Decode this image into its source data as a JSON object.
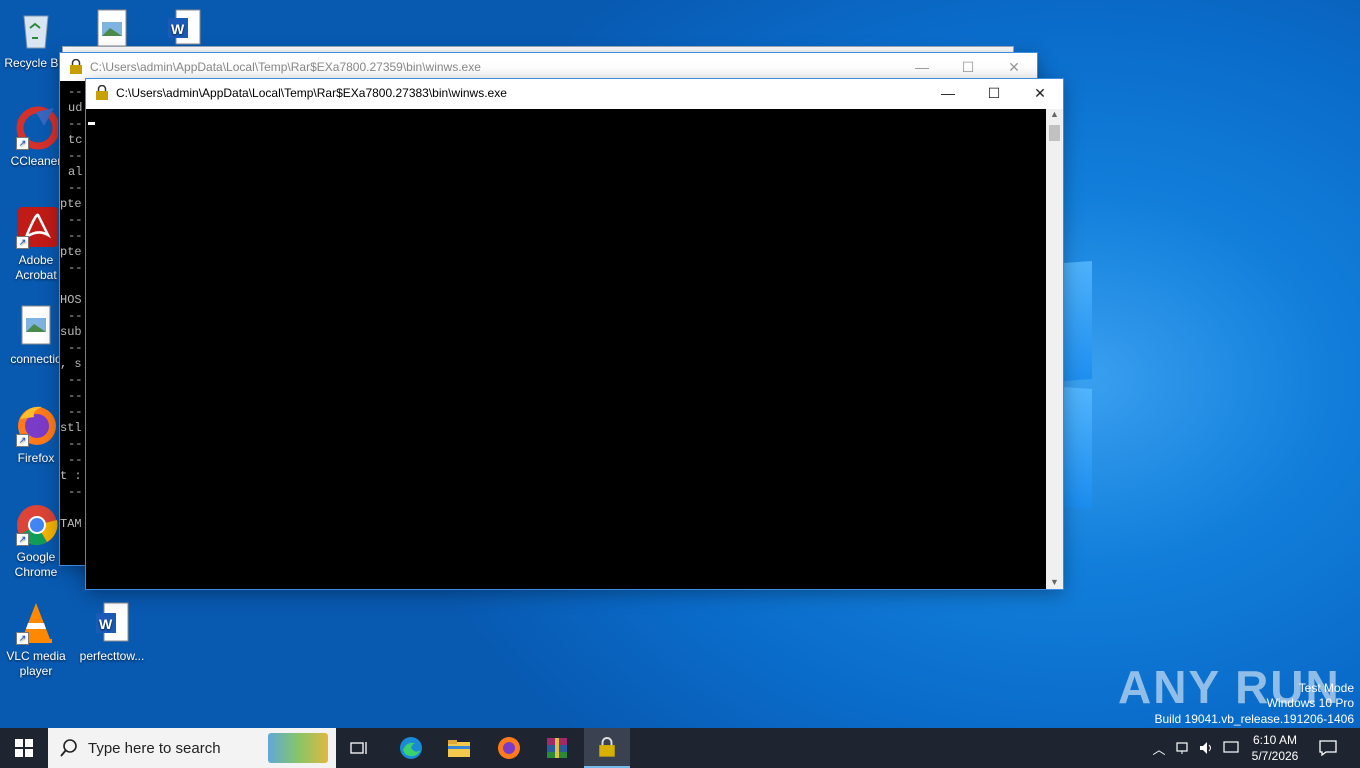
{
  "desktop_icons": [
    {
      "label": "Recycle Bin"
    },
    {
      "label": "CCleaner"
    },
    {
      "label": "Adobe Acrobat"
    },
    {
      "label": "connectio"
    },
    {
      "label": "Firefox"
    },
    {
      "label": "Google Chrome"
    },
    {
      "label": "VLC media player"
    },
    {
      "label": "perfecttow..."
    }
  ],
  "back_window": {
    "title": "C:\\Users\\admin\\AppData\\Local\\Temp\\Rar$EXa7800.27359\\bin\\winws.exe",
    "lines": [
      "--",
      "ud",
      "--",
      "tc",
      "--",
      "al",
      "--",
      "pte",
      "--",
      "--",
      "pte",
      "--",
      "",
      "HOS",
      "--",
      "sub",
      "--",
      ", s",
      "--",
      "--",
      "--",
      "stl",
      "--",
      "--",
      "t :",
      "--",
      "",
      "TAM"
    ]
  },
  "front_window": {
    "title": "C:\\Users\\admin\\AppData\\Local\\Temp\\Rar$EXa7800.27383\\bin\\winws.exe",
    "minimize": "—",
    "maximize": "☐",
    "close": "✕"
  },
  "taskbar": {
    "search_placeholder": "Type here to search",
    "time": "6:10 AM",
    "date": "5/7/2026"
  },
  "watermark": {
    "line1": "Test Mode",
    "line2": "Windows 10 Pro",
    "line3": "Build 19041.vb_release.191206-1406"
  },
  "brand": "ANY RUN",
  "colors": {
    "desktop": "#0a6bc9",
    "taskbar": "#1f2530",
    "console": "#000000"
  }
}
